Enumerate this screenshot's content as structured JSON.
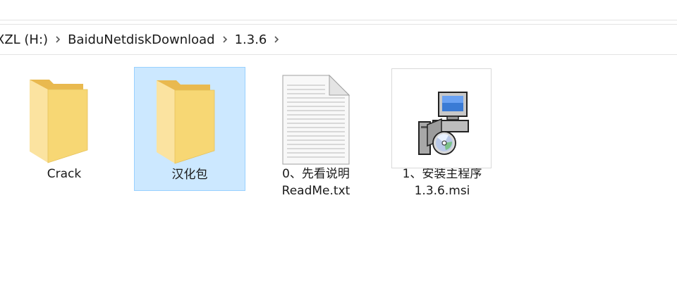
{
  "breadcrumb": {
    "items": [
      {
        "label": "XZL (H:)"
      },
      {
        "label": "BaiduNetdiskDownload"
      },
      {
        "label": "1.3.6"
      }
    ]
  },
  "files": [
    {
      "name_line1": "Crack",
      "name_line2": "",
      "type": "folder",
      "icon": "folder-icon"
    },
    {
      "name_line1": "汉化包",
      "name_line2": "",
      "type": "folder",
      "icon": "folder-icon",
      "selected": true
    },
    {
      "name_line1": "0、先看说明",
      "name_line2": "ReadMe.txt",
      "type": "text",
      "icon": "text-file-icon"
    },
    {
      "name_line1": "1、安装主程序",
      "name_line2": "1.3.6.msi",
      "type": "installer",
      "icon": "installer-icon"
    }
  ],
  "colors": {
    "selection_bg": "#cce8ff",
    "selection_border": "#99d1ff",
    "folder_front": "#f7d774",
    "folder_back": "#e9b94f"
  }
}
